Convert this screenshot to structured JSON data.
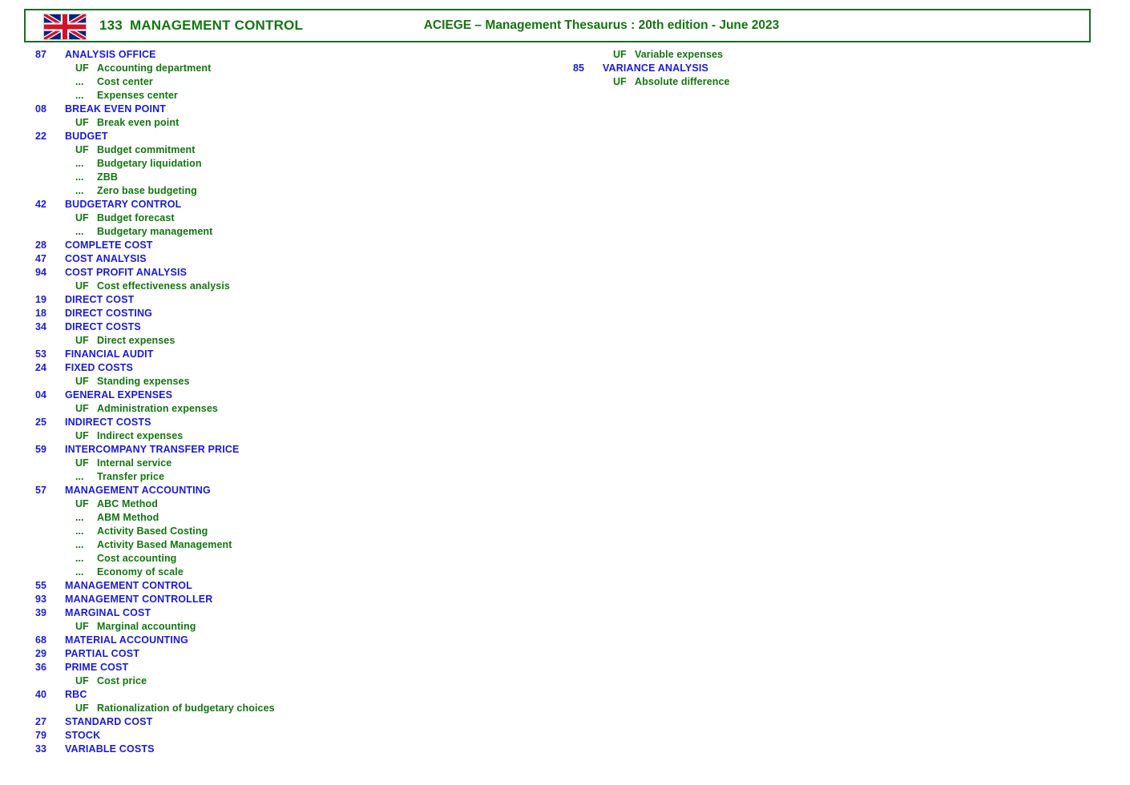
{
  "header": {
    "flag_icon": "uk-flag-icon",
    "section_number": "133",
    "section_name": "MANAGEMENT CONTROL",
    "title": "ACIEGE  –  Management Thesaurus :   20th edition  -  June 2023",
    "border_color": "#1d6b2a",
    "text_color": "#12760f"
  },
  "colors": {
    "descriptor_blue": "#1a1ad6",
    "nondescriptor_green": "#12760f",
    "page_background": "#ffffff"
  },
  "columns": [
    {
      "id": "column-left",
      "entries": [
        {
          "type": "main",
          "num": "87",
          "term": "ANALYSIS OFFICE"
        },
        {
          "type": "sub",
          "marker": "UF",
          "term": "Accounting department"
        },
        {
          "type": "sub",
          "marker": "...",
          "term": "Cost center"
        },
        {
          "type": "sub",
          "marker": "...",
          "term": "Expenses center"
        },
        {
          "type": "main",
          "num": "08",
          "term": "BREAK EVEN POINT"
        },
        {
          "type": "sub",
          "marker": "UF",
          "term": "Break even point"
        },
        {
          "type": "main",
          "num": "22",
          "term": "BUDGET"
        },
        {
          "type": "sub",
          "marker": "UF",
          "term": "Budget commitment"
        },
        {
          "type": "sub",
          "marker": "...",
          "term": "Budgetary liquidation"
        },
        {
          "type": "sub",
          "marker": "...",
          "term": "ZBB"
        },
        {
          "type": "sub",
          "marker": "...",
          "term": "Zero base budgeting"
        },
        {
          "type": "main",
          "num": "42",
          "term": "BUDGETARY CONTROL"
        },
        {
          "type": "sub",
          "marker": "UF",
          "term": "Budget forecast"
        },
        {
          "type": "sub",
          "marker": "...",
          "term": "Budgetary management"
        },
        {
          "type": "main",
          "num": "28",
          "term": "COMPLETE COST"
        },
        {
          "type": "main",
          "num": "47",
          "term": "COST ANALYSIS"
        },
        {
          "type": "main",
          "num": "94",
          "term": "COST PROFIT ANALYSIS"
        },
        {
          "type": "sub",
          "marker": "UF",
          "term": "Cost effectiveness analysis"
        },
        {
          "type": "main",
          "num": "19",
          "term": "DIRECT COST"
        },
        {
          "type": "main",
          "num": "18",
          "term": "DIRECT COSTING"
        },
        {
          "type": "main",
          "num": "34",
          "term": "DIRECT COSTS"
        },
        {
          "type": "sub",
          "marker": "UF",
          "term": "Direct expenses"
        },
        {
          "type": "main",
          "num": "53",
          "term": "FINANCIAL AUDIT"
        },
        {
          "type": "main",
          "num": "24",
          "term": "FIXED COSTS"
        },
        {
          "type": "sub",
          "marker": "UF",
          "term": "Standing expenses"
        },
        {
          "type": "main",
          "num": "04",
          "term": "GENERAL EXPENSES"
        },
        {
          "type": "sub",
          "marker": "UF",
          "term": "Administration expenses"
        },
        {
          "type": "main",
          "num": "25",
          "term": "INDIRECT COSTS"
        },
        {
          "type": "sub",
          "marker": "UF",
          "term": "Indirect expenses"
        },
        {
          "type": "main",
          "num": "59",
          "term": "INTERCOMPANY TRANSFER PRICE"
        },
        {
          "type": "sub",
          "marker": "UF",
          "term": "Internal service"
        },
        {
          "type": "sub",
          "marker": "...",
          "term": "Transfer price"
        },
        {
          "type": "main",
          "num": "57",
          "term": "MANAGEMENT ACCOUNTING"
        },
        {
          "type": "sub",
          "marker": "UF",
          "term": "ABC Method"
        },
        {
          "type": "sub",
          "marker": "...",
          "term": "ABM Method"
        },
        {
          "type": "sub",
          "marker": "...",
          "term": "Activity Based Costing"
        },
        {
          "type": "sub",
          "marker": "...",
          "term": "Activity Based Management"
        },
        {
          "type": "sub",
          "marker": "...",
          "term": "Cost accounting"
        },
        {
          "type": "sub",
          "marker": "...",
          "term": "Economy of scale"
        },
        {
          "type": "main",
          "num": "55",
          "term": "MANAGEMENT CONTROL"
        },
        {
          "type": "main",
          "num": "93",
          "term": "MANAGEMENT CONTROLLER"
        },
        {
          "type": "main",
          "num": "39",
          "term": "MARGINAL COST"
        },
        {
          "type": "sub",
          "marker": "UF",
          "term": "Marginal accounting"
        },
        {
          "type": "main",
          "num": "68",
          "term": "MATERIAL ACCOUNTING"
        },
        {
          "type": "main",
          "num": "29",
          "term": "PARTIAL COST"
        },
        {
          "type": "main",
          "num": "36",
          "term": "PRIME COST"
        },
        {
          "type": "sub",
          "marker": "UF",
          "term": "Cost price"
        },
        {
          "type": "main",
          "num": "40",
          "term": "RBC"
        },
        {
          "type": "sub",
          "marker": "UF",
          "term": "Rationalization of budgetary choices"
        },
        {
          "type": "main",
          "num": "27",
          "term": "STANDARD COST"
        },
        {
          "type": "main",
          "num": "79",
          "term": "STOCK"
        },
        {
          "type": "main",
          "num": "33",
          "term": "VARIABLE COSTS"
        }
      ]
    },
    {
      "id": "column-right",
      "entries": [
        {
          "type": "sub",
          "marker": "UF",
          "term": "Variable expenses"
        },
        {
          "type": "main",
          "num": "85",
          "term": "VARIANCE ANALYSIS"
        },
        {
          "type": "sub",
          "marker": "UF",
          "term": "Absolute difference"
        }
      ]
    }
  ]
}
